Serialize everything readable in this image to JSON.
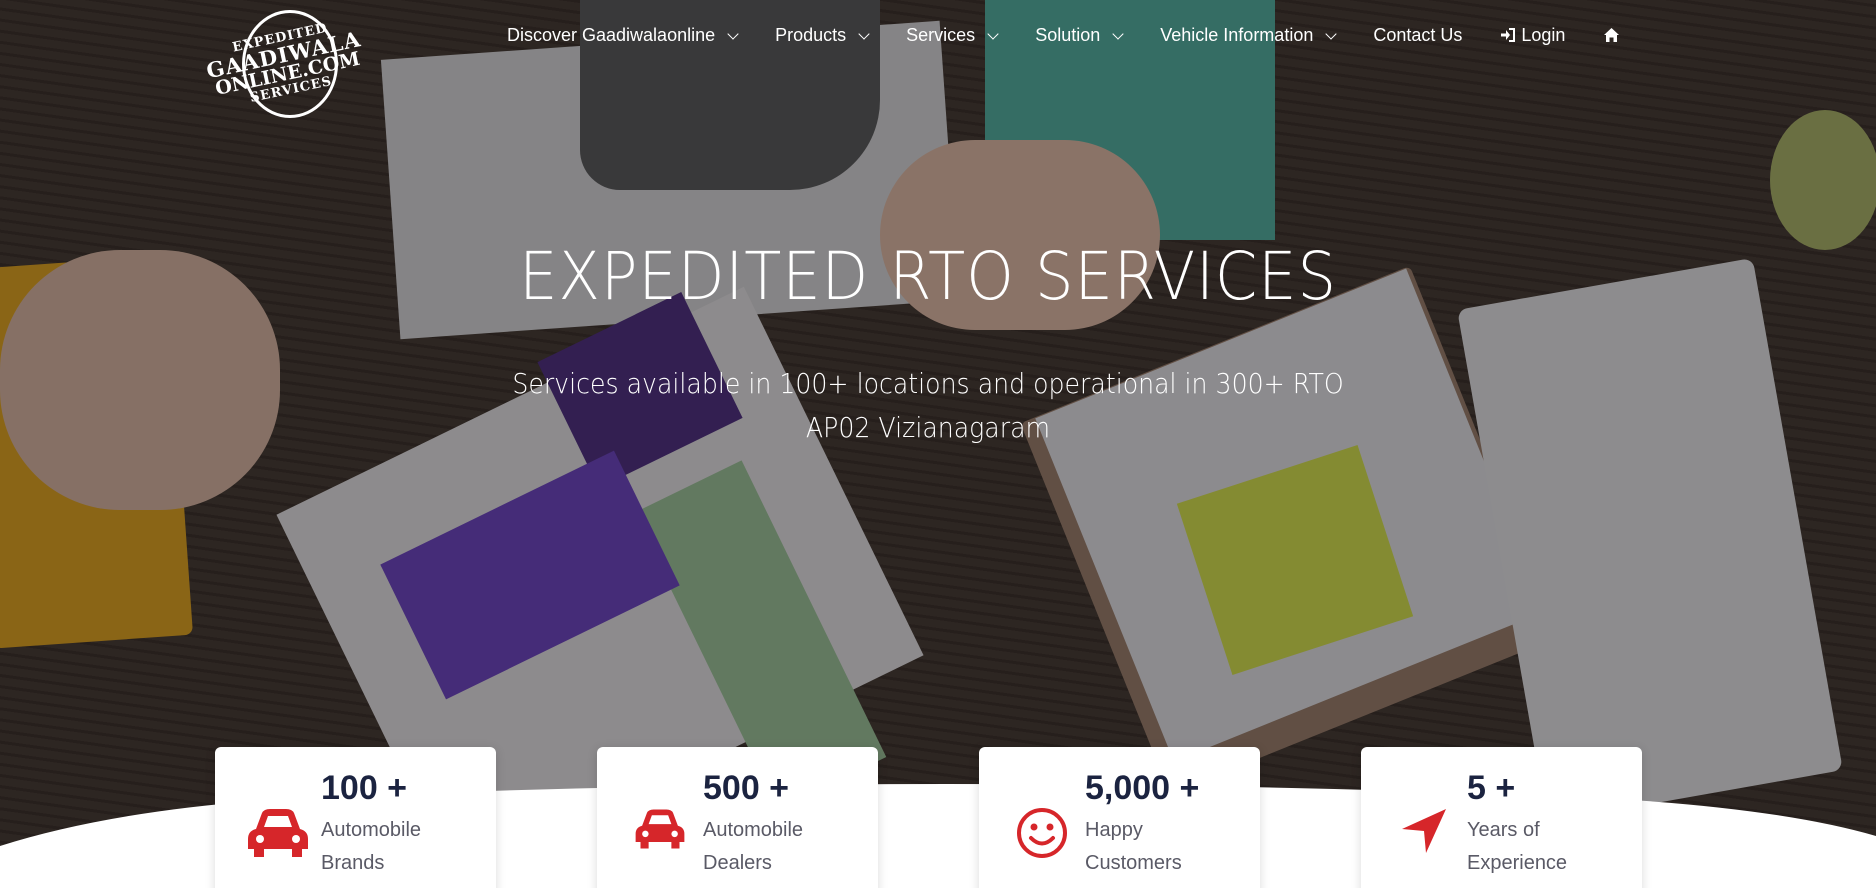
{
  "brand": {
    "logo_line1": "EXPEDITED",
    "logo_line2": "GAADIWALA",
    "logo_line3": "ONLINE.COM",
    "logo_line4": "SERVICES"
  },
  "nav": {
    "items": [
      {
        "label": "Discover Gaadiwalaonline",
        "has_dropdown": true
      },
      {
        "label": "Products",
        "has_dropdown": true
      },
      {
        "label": "Services",
        "has_dropdown": true
      },
      {
        "label": "Solution",
        "has_dropdown": true
      },
      {
        "label": "Vehicle Information",
        "has_dropdown": true
      },
      {
        "label": "Contact Us",
        "has_dropdown": false
      }
    ],
    "login_label": "Login",
    "login_icon": "sign-in-icon",
    "home_icon": "home-icon"
  },
  "hero": {
    "title": "EXPEDITED RTO SERVICES",
    "subtitle_line1": "Services available in 100+ locations and operational in 300+ RTO",
    "subtitle_line2": "AP02 Vizianagaram"
  },
  "stats": [
    {
      "value": "100 +",
      "label_line1": "Automobile",
      "label_line2": "Brands",
      "icon": "car-icon"
    },
    {
      "value": "500 +",
      "label_line1": "Automobile",
      "label_line2": "Dealers",
      "icon": "car-icon"
    },
    {
      "value": "5,000 +",
      "label_line1": "Happy",
      "label_line2": "Customers",
      "icon": "smile-icon"
    },
    {
      "value": "5 +",
      "label_line1": "Years of",
      "label_line2": "Experience",
      "icon": "location-arrow-icon"
    }
  ],
  "colors": {
    "accent_red": "#d6262a",
    "stat_number": "#1b2340",
    "stat_label": "#5a5a66"
  }
}
